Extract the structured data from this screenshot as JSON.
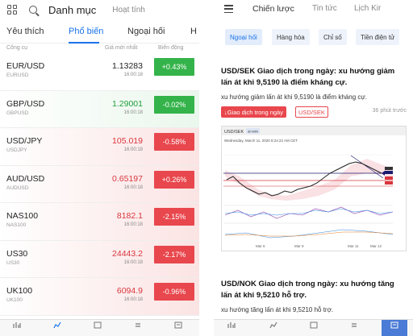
{
  "left": {
    "header": {
      "title": "Danh mục",
      "subtitle": "Hoạt tính",
      "grid_icon": "grid-icon",
      "search_icon": "search-icon"
    },
    "tabs": [
      {
        "label": "Yêu thích",
        "active": false
      },
      {
        "label": "Phổ biến",
        "active": true
      },
      {
        "label": "Ngoại hối",
        "active": false
      },
      {
        "label": "H",
        "active": false
      }
    ],
    "columns": {
      "symbol": "Công cụ",
      "price": "Giá mới nhất",
      "change": "Biến động"
    },
    "rows": [
      {
        "symbol": "EUR/USD",
        "sub": "EURUSD",
        "price": "1.13283",
        "time": "16:00:18",
        "change": "+0.43%",
        "dir": "plain"
      },
      {
        "symbol": "GBP/USD",
        "sub": "GBPUSD",
        "price": "1.29001",
        "time": "16:00:18",
        "change": "-0.02%",
        "dir": "up"
      },
      {
        "symbol": "USD/JPY",
        "sub": "USDJPY",
        "price": "105.019",
        "time": "16:00:18",
        "change": "-0.58%",
        "dir": "down"
      },
      {
        "symbol": "AUD/USD",
        "sub": "AUDUSD",
        "price": "0.65197",
        "time": "16:00:18",
        "change": "+0.26%",
        "dir": "down"
      },
      {
        "symbol": "NAS100",
        "sub": "NAS100",
        "price": "8182.1",
        "time": "16:00:18",
        "change": "-2.15%",
        "dir": "down"
      },
      {
        "symbol": "US30",
        "sub": "US30",
        "price": "24443.2",
        "time": "16:00:18",
        "change": "-2.17%",
        "dir": "down"
      },
      {
        "symbol": "UK100",
        "sub": "UK100",
        "price": "6094.9",
        "time": "16:00:18",
        "change": "-0.96%",
        "dir": "down"
      }
    ],
    "nav": [
      {
        "icon": "markets-icon"
      },
      {
        "icon": "chart-icon"
      },
      {
        "icon": "calendar-icon"
      },
      {
        "icon": "trade-icon"
      },
      {
        "icon": "news-icon"
      }
    ]
  },
  "right": {
    "menu_icon": "hamburger-icon",
    "tabs": [
      {
        "label": "Chiến lược",
        "active": true
      },
      {
        "label": "Tin tức",
        "active": false
      },
      {
        "label": "Lịch Kir",
        "active": false
      }
    ],
    "chips": [
      {
        "label": "Ngoại hối",
        "active": true
      },
      {
        "label": "Hàng hóa",
        "active": false
      },
      {
        "label": "Chỉ số",
        "active": false
      },
      {
        "label": "Tiền điện tử",
        "active": false
      }
    ],
    "article1": {
      "title": "USD/SEK Giao dịch trong ngày: xu hướng giảm lấn át khi 9,5190 là điểm kháng cự.",
      "summary": "xu hướng giảm lấn át khi 9,5190 là điểm kháng cự.",
      "tag": "↓Giao dịch trong ngày",
      "symbol": "USD/SEK",
      "ago": "36 phút trước"
    },
    "chart": {
      "symbol": "USD/SEK",
      "interval": "30 MIN",
      "date": "Wednesday, March 11, 2020 8:24:22 AM CET",
      "x_ticks": [
        "Mar 6",
        "Mar 9",
        "Mar 11",
        "Mar 12"
      ]
    },
    "article2": {
      "title": "USD/NOK Giao dịch trong ngày: xu hướng tăng lấn át khi 9,5210 hỗ trợ.",
      "summary": "xu hướng tăng lấn át khi 9,5210 hỗ trợ."
    },
    "nav": [
      {
        "icon": "markets-icon"
      },
      {
        "icon": "chart-icon"
      },
      {
        "icon": "calendar-icon"
      },
      {
        "icon": "trade-icon"
      },
      {
        "icon": "news-icon"
      }
    ]
  }
}
